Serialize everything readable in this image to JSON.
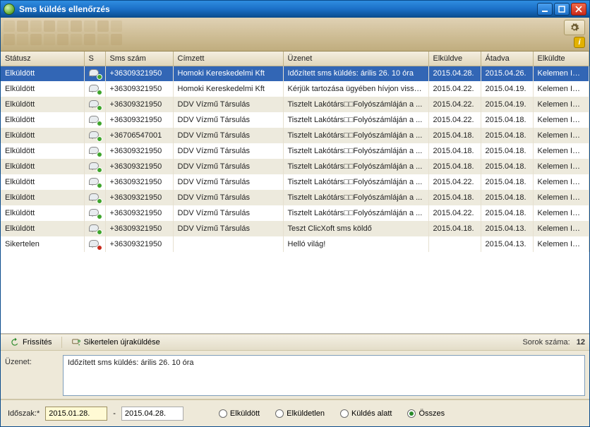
{
  "window": {
    "title": "Sms küldés ellenőrzés"
  },
  "columns": {
    "status": "Státusz",
    "s": "S",
    "num": "Sms szám",
    "rec": "Címzett",
    "msg": "Üzenet",
    "sent": "Elküldve",
    "deliv": "Átadva",
    "by": "Elküldte"
  },
  "rows": [
    {
      "status": "Elküldött",
      "ok": true,
      "num": "+36309321950",
      "rec": "Homoki Kereskedelmi Kft",
      "msg": "Időzített sms küldés: árilis 26. 10 óra",
      "sent": "2015.04.28.",
      "deliv": "2015.04.26.",
      "by": "Kelemen Imréné"
    },
    {
      "status": "Elküldött",
      "ok": true,
      "num": "+36309321950",
      "rec": "Homoki Kereskedelmi Kft",
      "msg": "Kérjük tartozása ügyében hívjon vissz...",
      "sent": "2015.04.22.",
      "deliv": "2015.04.19.",
      "by": "Kelemen Imréné"
    },
    {
      "status": "Elküldött",
      "ok": true,
      "num": "+36309321950",
      "rec": "DDV Vízmű Társulás",
      "msg": "Tisztelt Lakótárs□□Folyószámláján a ...",
      "sent": "2015.04.22.",
      "deliv": "2015.04.19.",
      "by": "Kelemen Imréné"
    },
    {
      "status": "Elküldött",
      "ok": true,
      "num": "+36309321950",
      "rec": "DDV Vízmű Társulás",
      "msg": "Tisztelt Lakótárs□□Folyószámláján a ...",
      "sent": "2015.04.22.",
      "deliv": "2015.04.18.",
      "by": "Kelemen Imréné"
    },
    {
      "status": "Elküldött",
      "ok": true,
      "num": "+36706547001",
      "rec": "DDV Vízmű Társulás",
      "msg": "Tisztelt Lakótárs□□Folyószámláján a ...",
      "sent": "2015.04.18.",
      "deliv": "2015.04.18.",
      "by": "Kelemen Imréné"
    },
    {
      "status": "Elküldött",
      "ok": true,
      "num": "+36309321950",
      "rec": "DDV Vízmű Társulás",
      "msg": "Tisztelt Lakótárs□□Folyószámláján a ...",
      "sent": "2015.04.18.",
      "deliv": "2015.04.18.",
      "by": "Kelemen Imréné"
    },
    {
      "status": "Elküldött",
      "ok": true,
      "num": "+36309321950",
      "rec": "DDV Vízmű Társulás",
      "msg": "Tisztelt Lakótárs□□Folyószámláján a ...",
      "sent": "2015.04.18.",
      "deliv": "2015.04.18.",
      "by": "Kelemen Imréné"
    },
    {
      "status": "Elküldött",
      "ok": true,
      "num": "+36309321950",
      "rec": "DDV Vízmű Társulás",
      "msg": "Tisztelt Lakótárs□□Folyószámláján a ...",
      "sent": "2015.04.22.",
      "deliv": "2015.04.18.",
      "by": "Kelemen Imréné"
    },
    {
      "status": "Elküldött",
      "ok": true,
      "num": "+36309321950",
      "rec": "DDV Vízmű Társulás",
      "msg": "Tisztelt Lakótárs□□Folyószámláján a ...",
      "sent": "2015.04.18.",
      "deliv": "2015.04.18.",
      "by": "Kelemen Imréné"
    },
    {
      "status": "Elküldött",
      "ok": true,
      "num": "+36309321950",
      "rec": "DDV Vízmű Társulás",
      "msg": "Tisztelt Lakótárs□□Folyószámláján a ...",
      "sent": "2015.04.22.",
      "deliv": "2015.04.18.",
      "by": "Kelemen Imréné"
    },
    {
      "status": "Elküldött",
      "ok": true,
      "num": "+36309321950",
      "rec": "DDV Vízmű Társulás",
      "msg": "Teszt ClicXoft sms köldő",
      "sent": "2015.04.18.",
      "deliv": "2015.04.13.",
      "by": "Kelemen Imréné"
    },
    {
      "status": "Sikertelen",
      "ok": false,
      "num": "+36309321950",
      "rec": "",
      "msg": "Helló világ!",
      "sent": "",
      "deliv": "2015.04.13.",
      "by": "Kelemen Imréné"
    }
  ],
  "actions": {
    "refresh": "Frissítés",
    "resend": "Sikertelen újraküldése",
    "rowcount_label": "Sorok száma:",
    "rowcount": "12"
  },
  "message_panel": {
    "label": "Üzenet:",
    "text": "Időzített sms küldés: árilis 26. 10 óra"
  },
  "filter": {
    "period_label": "Időszak:*",
    "from": "2015.01.28.",
    "dash": "-",
    "to": "2015.04.28.",
    "opt_sent": "Elküldött",
    "opt_unsent": "Elküldetlen",
    "opt_sending": "Küldés alatt",
    "opt_all": "Összes",
    "selected": "opt_all"
  }
}
